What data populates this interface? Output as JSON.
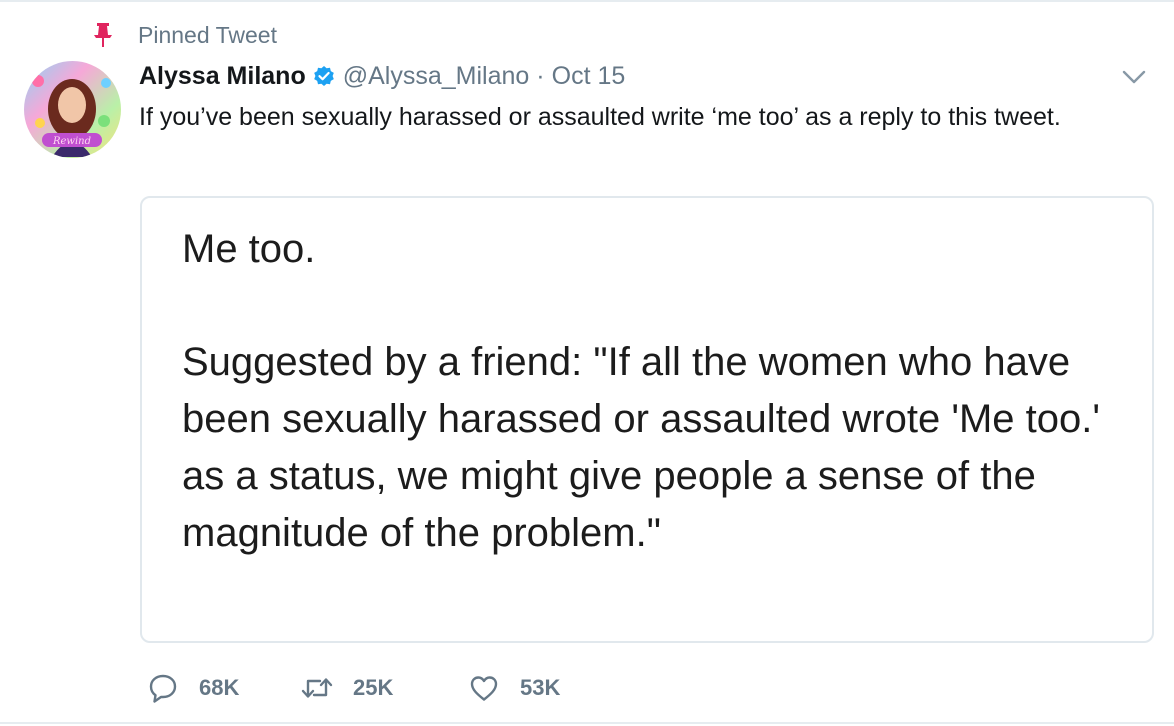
{
  "pinned": {
    "label": "Pinned Tweet",
    "icon": "pin-icon",
    "icon_color": "#e0245e"
  },
  "author": {
    "display_name": "Alyssa Milano",
    "verified_icon": "verified-badge-icon",
    "verified_color": "#1da1f2",
    "handle": "@Alyssa_Milano",
    "separator": "·",
    "date": "Oct 15"
  },
  "menu": {
    "icon": "chevron-down-icon"
  },
  "tweet": {
    "text": "If you’ve been sexually harassed or assaulted write ‘me too’ as a reply to this tweet."
  },
  "card": {
    "line1": "Me too.",
    "body": "Suggested by a friend: \"If all the women who have been sexually harassed or assaulted wrote 'Me too.' as a status, we might give people a sense of the magnitude of the problem.\""
  },
  "actions": {
    "reply": {
      "icon": "reply-icon",
      "count": "68K"
    },
    "retweet": {
      "icon": "retweet-icon",
      "count": "25K"
    },
    "like": {
      "icon": "heart-icon",
      "count": "53K"
    }
  },
  "colors": {
    "text": "#14171a",
    "muted": "#657786",
    "border": "#e1e8ed"
  }
}
